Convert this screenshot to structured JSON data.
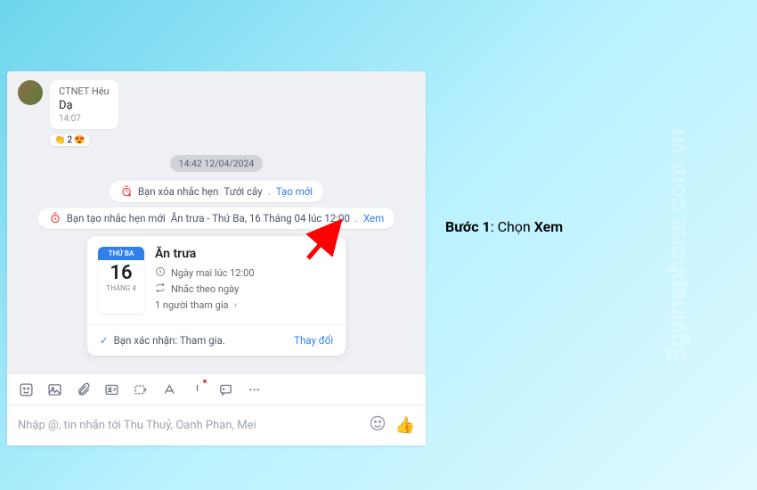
{
  "watermark": "3gvinaphone.com.vn",
  "message": {
    "reply_name": "CTNET Hêu",
    "text": "Dạ",
    "time": "14:07",
    "reaction_emoji": "👏",
    "reaction_count": "2",
    "reaction_emoji2": "😍"
  },
  "timestamp": "14:42 12/04/2024",
  "system1": {
    "text": "Bạn xóa nhắc hẹn ",
    "name": "Tưới cây",
    "sep": " . ",
    "action": "Tạo mới"
  },
  "system2": {
    "text": "Bạn tạo nhắc hẹn mới ",
    "name": "Ăn trưa - Thứ Ba, 16 Tháng 04 lúc 12:00",
    "sep": " . ",
    "action": "Xem"
  },
  "event": {
    "day_head": "THỨ BA",
    "day_num": "16",
    "month": "THÁNG 4",
    "title": "Ăn trưa",
    "when": "Ngày mai lúc 12:00",
    "repeat": "Nhắc theo ngày",
    "participants": "1 người tham gia",
    "confirm": "Bạn xác nhận: Tham gia.",
    "change": "Thay đổi"
  },
  "input": {
    "placeholder": "Nhập @, tin nhắn tới Thu Thuỷ, Oanh Phan, Mei"
  },
  "instruction": {
    "step": "Bước 1",
    "colon": ":  ",
    "action_prefix": "Chọn ",
    "action_bold": "Xem"
  }
}
